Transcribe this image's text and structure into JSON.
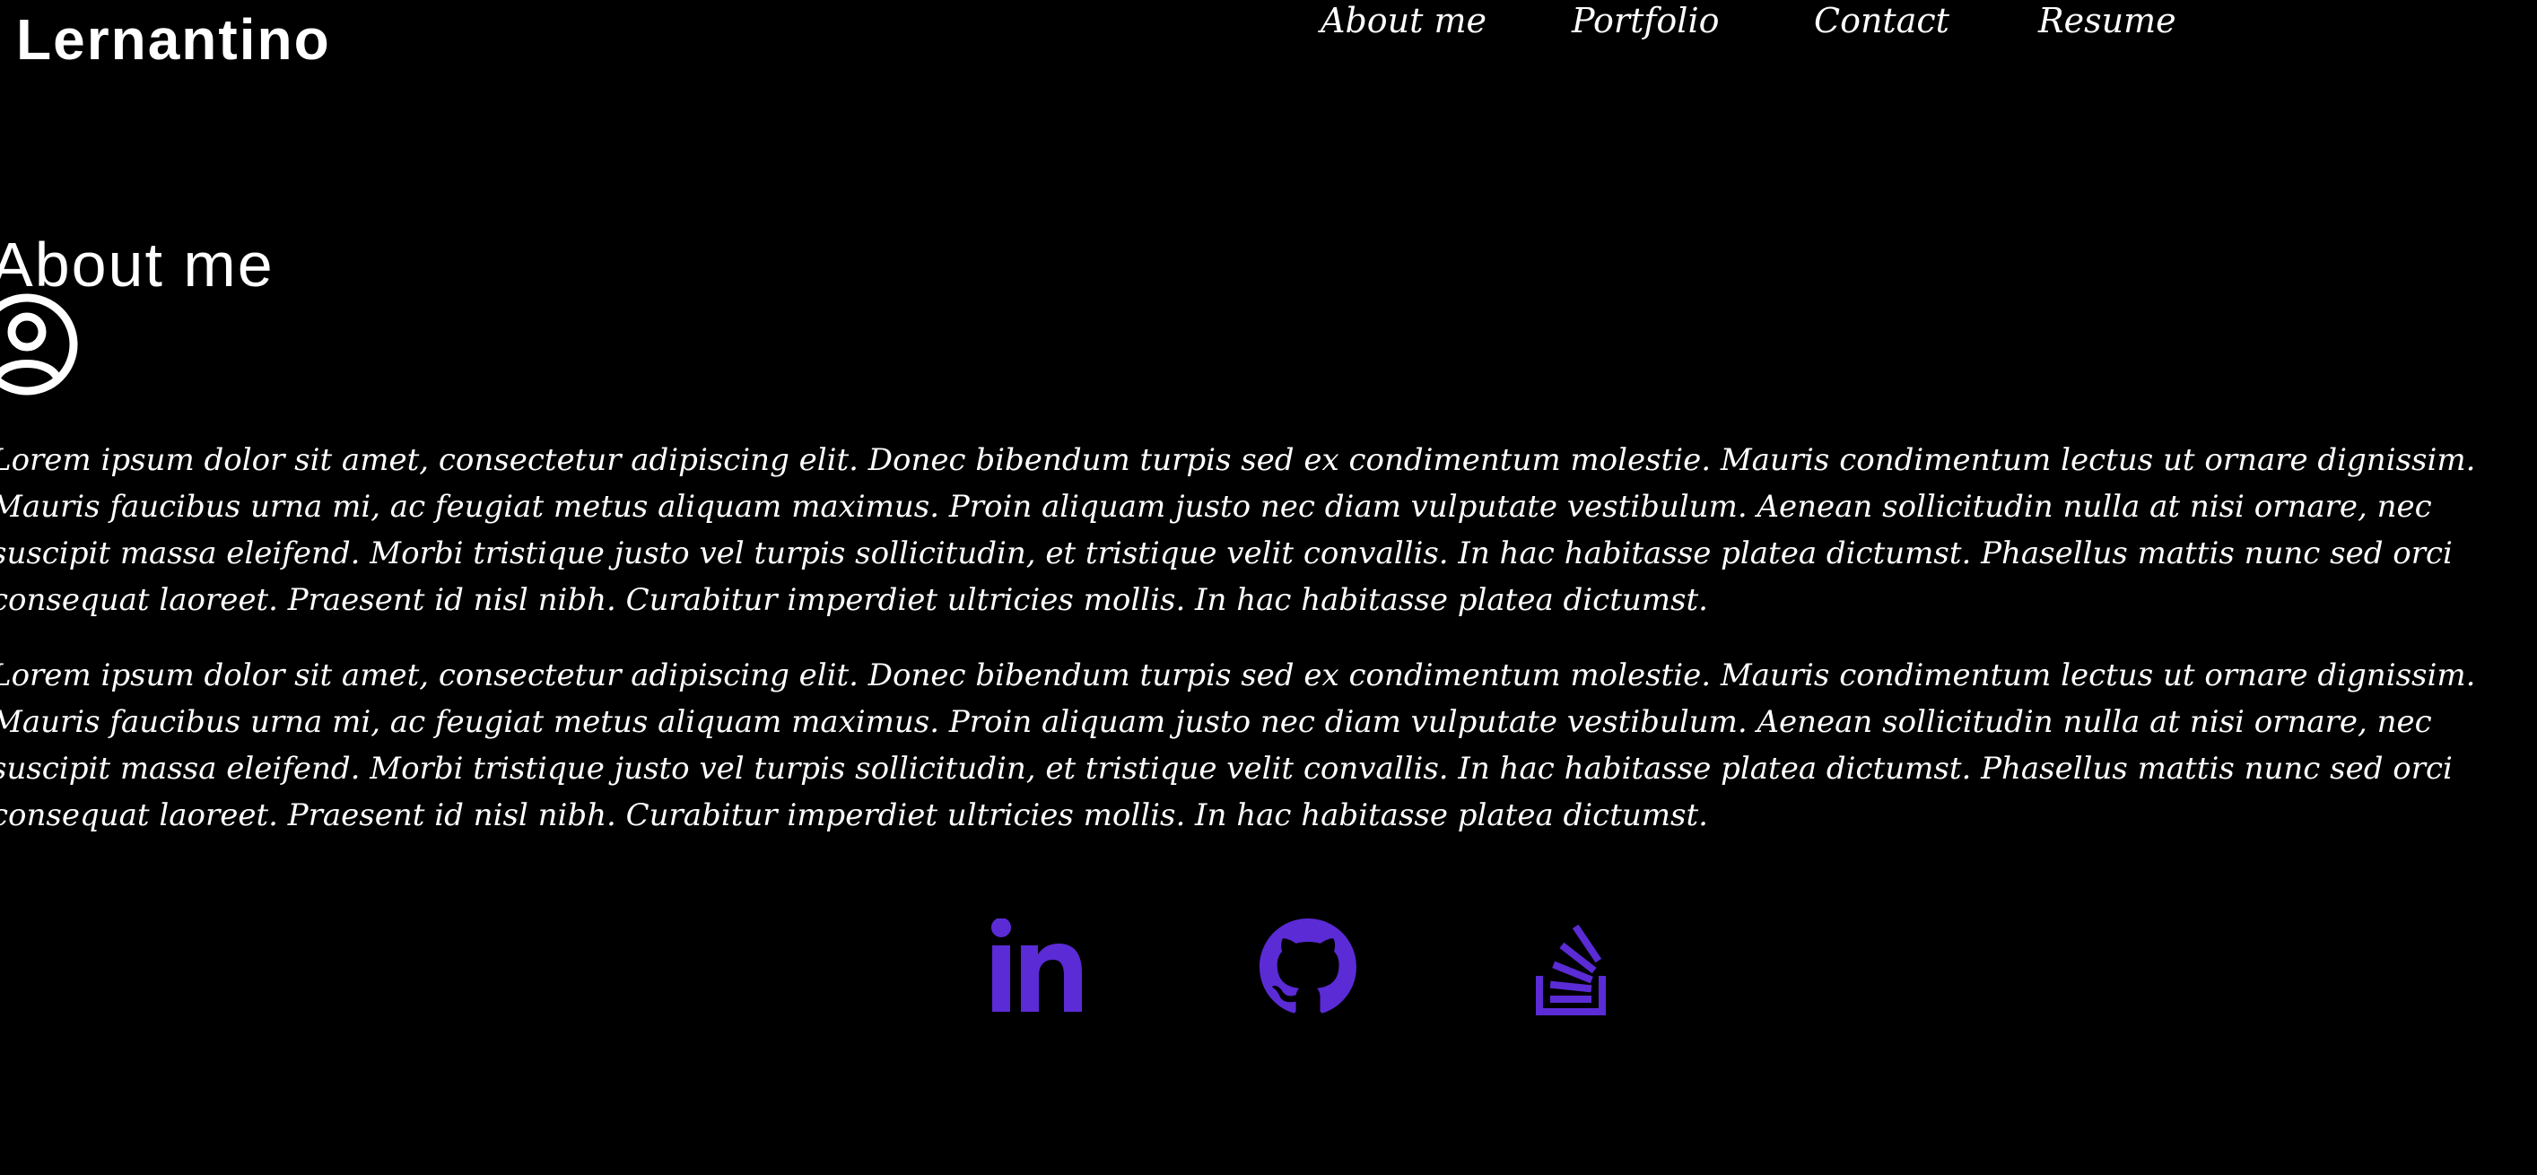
{
  "header": {
    "brand": "Lernantino",
    "nav": [
      {
        "label": "About me"
      },
      {
        "label": "Portfolio"
      },
      {
        "label": "Contact"
      },
      {
        "label": "Resume"
      }
    ]
  },
  "about": {
    "title": "About me",
    "avatar_icon": "user-circle-icon",
    "paragraphs": [
      {
        "lines": [
          "Lorem ipsum dolor sit amet, consectetur adipiscing elit. Donec bibendum turpis sed ex condimentum molestie. Mauris condimentum lectus ut ornare dignissim.",
          "Mauris faucibus urna mi, ac feugiat metus aliquam maximus. Proin aliquam justo nec diam vulputate vestibulum. Aenean sollicitudin nulla at nisi ornare, nec",
          "suscipit massa eleifend. Morbi tristique justo vel turpis sollicitudin, et tristique velit convallis. In hac habitasse platea dictumst. Phasellus mattis nunc sed orci",
          "consequat laoreet. Praesent id nisl nibh. Curabitur imperdiet ultricies mollis. In hac habitasse platea dictumst."
        ]
      },
      {
        "lines": [
          "Lorem ipsum dolor sit amet, consectetur adipiscing elit. Donec bibendum turpis sed ex condimentum molestie. Mauris condimentum lectus ut ornare dignissim.",
          "Mauris faucibus urna mi, ac feugiat metus aliquam maximus. Proin aliquam justo nec diam vulputate vestibulum. Aenean sollicitudin nulla at nisi ornare, nec",
          "suscipit massa eleifend. Morbi tristique justo vel turpis sollicitudin, et tristique velit convallis. In hac habitasse platea dictumst. Phasellus mattis nunc sed orci",
          "consequat laoreet. Praesent id nisl nibh. Curabitur imperdiet ultricies mollis. In hac habitasse platea dictumst."
        ]
      }
    ]
  },
  "social": [
    {
      "icon": "linkedin-icon"
    },
    {
      "icon": "github-icon"
    },
    {
      "icon": "stackoverflow-icon"
    }
  ],
  "colors": {
    "background": "#000000",
    "text": "#ffffff",
    "accent": "#5b2bd6"
  }
}
